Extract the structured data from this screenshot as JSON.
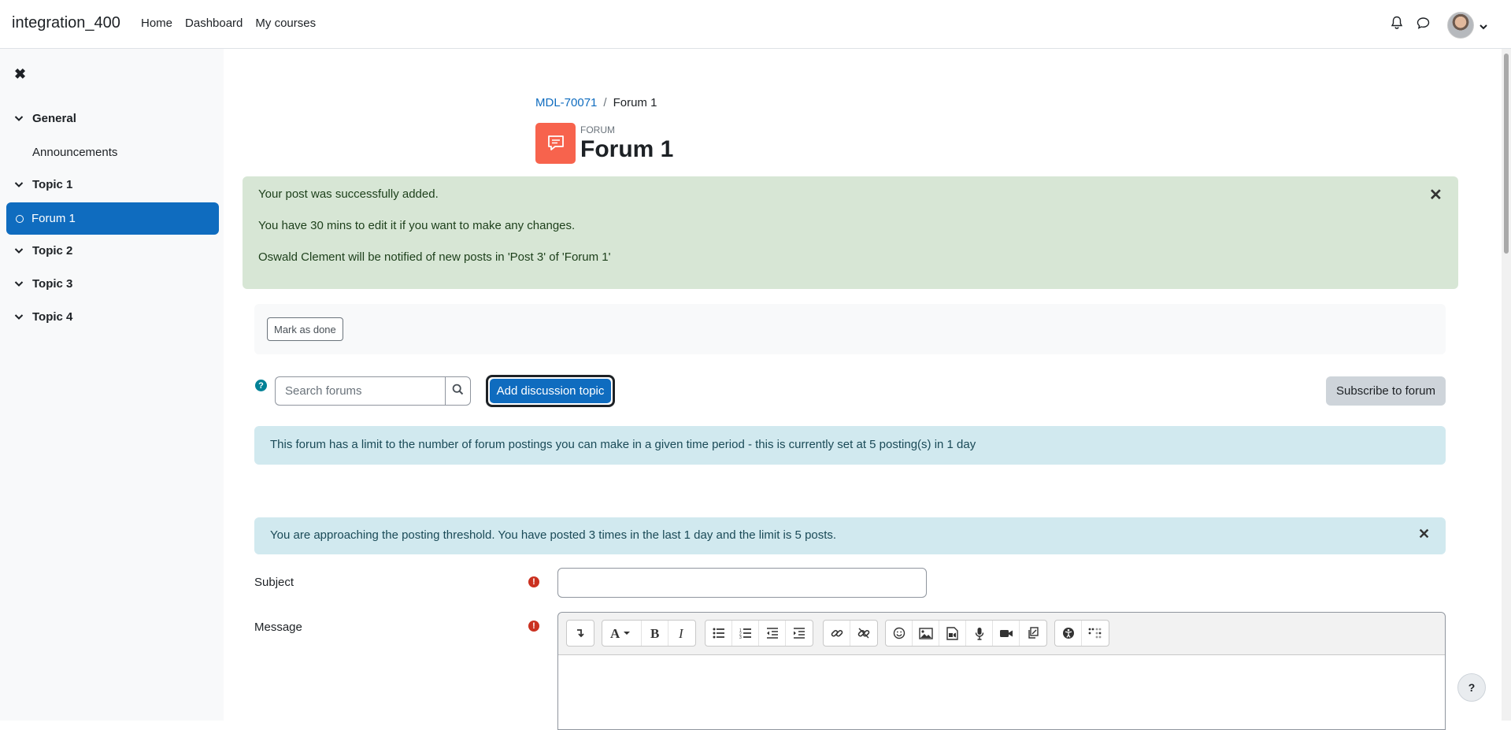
{
  "navbar": {
    "site_name": "integration_400",
    "links": [
      "Home",
      "Dashboard",
      "My courses"
    ],
    "icons": [
      "bell-icon",
      "speech-bubble-icon",
      "avatar",
      "chevron-down-icon"
    ]
  },
  "drawer": {
    "close_glyph": "✖",
    "sections": [
      {
        "label": "General",
        "expanded": true
      },
      {
        "label": "Topic 1",
        "expanded": true
      },
      {
        "label": "Topic 2",
        "expanded": true
      },
      {
        "label": "Topic 3",
        "expanded": true
      },
      {
        "label": "Topic 4",
        "expanded": true
      }
    ],
    "items": [
      {
        "label": "Announcements",
        "active": false
      },
      {
        "label": "Forum 1",
        "active": true
      }
    ]
  },
  "breadcrumb": {
    "course": "MDL-70071",
    "separator": "/",
    "current": "Forum 1"
  },
  "header": {
    "kicker": "FORUM",
    "title": "Forum 1"
  },
  "success_alert": {
    "messages": [
      "Your post was successfully added.",
      "You have 30 mins to edit it if you want to make any changes.",
      "Oswald Clement will be notified of new posts in 'Post 3' of 'Forum 1'"
    ],
    "close": "✕"
  },
  "completion": {
    "button": "Mark as done"
  },
  "toolbar": {
    "help_glyph": "?",
    "search_placeholder": "Search forums",
    "add_button": "Add discussion topic",
    "subscribe_button": "Subscribe to forum"
  },
  "limit_notice": "This forum has a limit to the number of forum postings you can make in a given time period - this is currently set at 5 posting(s) in 1 day",
  "threshold_notice": {
    "text": "You are approaching the posting threshold. You have posted 3 times in the last 1 day and the limit is 5 posts.",
    "close": "✕"
  },
  "form": {
    "subject_label": "Subject",
    "message_label": "Message",
    "required_glyph": "!"
  },
  "page_help": "?",
  "colors": {
    "primary": "#0f6cbf",
    "success_bg": "#d7e6d5",
    "info_bg": "#d1e9ef",
    "forum_icon": "#f7634d",
    "required": "#ca3120"
  }
}
